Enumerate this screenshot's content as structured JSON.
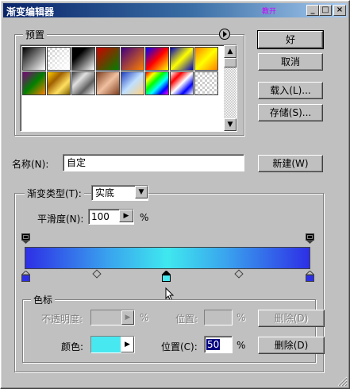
{
  "window": {
    "title": "渐变编辑器",
    "title_mark": "教开"
  },
  "buttons": {
    "ok": "好",
    "cancel": "取消",
    "load": "载入(L)...",
    "save": "存储(S)...",
    "new": "新建(W)",
    "delete_opacity": "删除(D)",
    "delete_color": "删除(D)"
  },
  "presets": {
    "label": "预置"
  },
  "name": {
    "label": "名称(N):",
    "value": "自定"
  },
  "gradient_type": {
    "label": "渐变类型(T):",
    "value": "实底"
  },
  "smoothness": {
    "label": "平滑度(N):",
    "value": "100",
    "unit": "%"
  },
  "color_stops": {
    "label": "色标",
    "opacity_label": "不透明度:",
    "opacity_unit": "%",
    "opacity_location_label": "位置:",
    "opacity_location_unit": "%",
    "color_label": "颜色:",
    "location_label": "位置(C):",
    "location_value": "50",
    "location_unit": "%"
  },
  "colors": {
    "gradient_edge": "#2d2fe6",
    "gradient_mid": "#3fe8ef",
    "selected_stop": "#48e8f0"
  }
}
